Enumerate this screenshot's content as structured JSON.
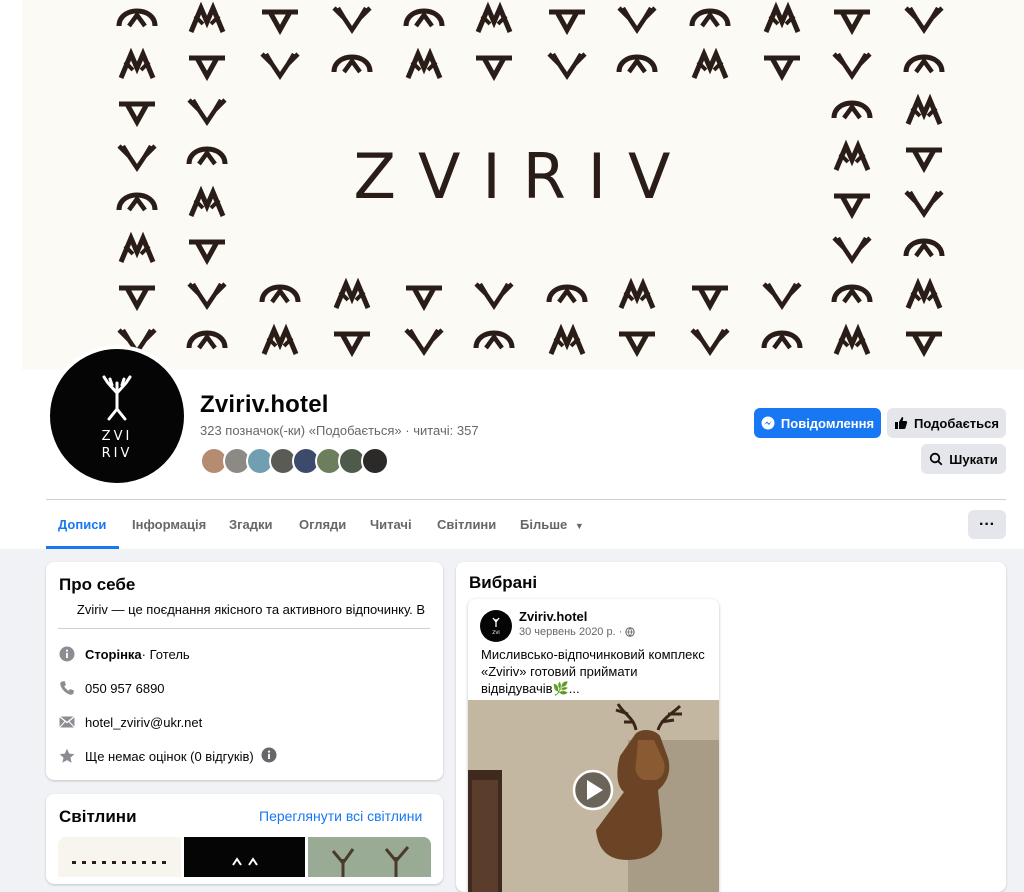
{
  "page": {
    "name": "Zviriv.hotel",
    "likes_count": "323 позначок(-ки) «Подобається»",
    "separator": "·",
    "followers": "читачі: 357",
    "cover_wordmark": "ZVIRIV",
    "avatar_text": [
      "ZVI",
      "RIV"
    ]
  },
  "actions": {
    "message_label": "Повідомлення",
    "like_label": "Подобається",
    "search_label": "Шукати",
    "more_label": "···"
  },
  "tabs": [
    {
      "label": "Дописи",
      "active": true
    },
    {
      "label": "Інформація"
    },
    {
      "label": "Згадки"
    },
    {
      "label": "Огляди"
    },
    {
      "label": "Читачі"
    },
    {
      "label": "Світлини"
    },
    {
      "label": "Більше"
    }
  ],
  "about": {
    "title": "Про себе",
    "description": "Zviriv — це поєднання якісного та активного відпочинку. В",
    "category_label": "Сторінка",
    "category_value": " · Готель",
    "phone": "050 957 6890",
    "email": "hotel_zviriv@ukr.net",
    "rating": "Ще немає оцінок (0 відгуків)"
  },
  "photos": {
    "title": "Світлини",
    "see_all": "Переглянути всі світлини"
  },
  "featured": {
    "title": "Вибрані",
    "post": {
      "author": "Zviriv.hotel",
      "date": "30 червень 2020 р. ·",
      "text": "Мисливсько-відпочинковий комплекс «Zviriv» готовий приймати відвідувачів🌿..."
    }
  },
  "colors": {
    "accent": "#1877f2",
    "background": "#f0f2f5",
    "secondary_button": "#e4e6eb",
    "muted_text": "#65676b"
  },
  "icons": [
    "messenger-icon",
    "thumbs-up-icon",
    "search-icon",
    "info-icon",
    "phone-icon",
    "mail-icon",
    "star-icon",
    "globe-icon",
    "play-icon",
    "caret-down-icon"
  ]
}
